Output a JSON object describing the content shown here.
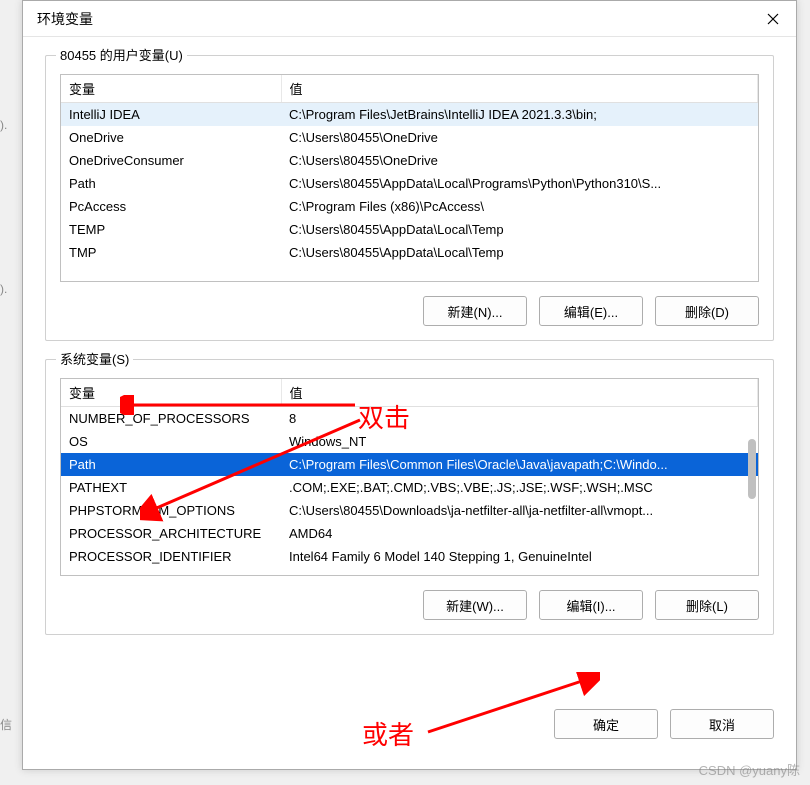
{
  "dialog": {
    "title": "环境变量",
    "close_aria": "关闭"
  },
  "user_vars": {
    "group_label": "80455 的用户变量(U)",
    "columns": {
      "var": "变量",
      "val": "值"
    },
    "rows": [
      {
        "var": "IntelliJ IDEA",
        "val": "C:\\Program Files\\JetBrains\\IntelliJ IDEA 2021.3.3\\bin;"
      },
      {
        "var": "OneDrive",
        "val": "C:\\Users\\80455\\OneDrive"
      },
      {
        "var": "OneDriveConsumer",
        "val": "C:\\Users\\80455\\OneDrive"
      },
      {
        "var": "Path",
        "val": "C:\\Users\\80455\\AppData\\Local\\Programs\\Python\\Python310\\S..."
      },
      {
        "var": "PcAccess",
        "val": "C:\\Program Files (x86)\\PcAccess\\"
      },
      {
        "var": "TEMP",
        "val": "C:\\Users\\80455\\AppData\\Local\\Temp"
      },
      {
        "var": "TMP",
        "val": "C:\\Users\\80455\\AppData\\Local\\Temp"
      }
    ],
    "buttons": {
      "new": "新建(N)...",
      "edit": "编辑(E)...",
      "delete": "删除(D)"
    }
  },
  "sys_vars": {
    "group_label": "系统变量(S)",
    "columns": {
      "var": "变量",
      "val": "值"
    },
    "rows": [
      {
        "var": "NUMBER_OF_PROCESSORS",
        "val": "8"
      },
      {
        "var": "OS",
        "val": "Windows_NT"
      },
      {
        "var": "Path",
        "val": "C:\\Program Files\\Common Files\\Oracle\\Java\\javapath;C:\\Windo..."
      },
      {
        "var": "PATHEXT",
        "val": ".COM;.EXE;.BAT;.CMD;.VBS;.VBE;.JS;.JSE;.WSF;.WSH;.MSC"
      },
      {
        "var": "PHPSTORM_VM_OPTIONS",
        "val": "C:\\Users\\80455\\Downloads\\ja-netfilter-all\\ja-netfilter-all\\vmopt..."
      },
      {
        "var": "PROCESSOR_ARCHITECTURE",
        "val": "AMD64"
      },
      {
        "var": "PROCESSOR_IDENTIFIER",
        "val": "Intel64 Family 6 Model 140 Stepping 1, GenuineIntel"
      }
    ],
    "buttons": {
      "new": "新建(W)...",
      "edit": "编辑(I)...",
      "delete": "删除(L)"
    }
  },
  "dialog_buttons": {
    "ok": "确定",
    "cancel": "取消"
  },
  "annotations": {
    "double_click": "双击",
    "or": "或者"
  },
  "watermark": "CSDN @yuany陈"
}
